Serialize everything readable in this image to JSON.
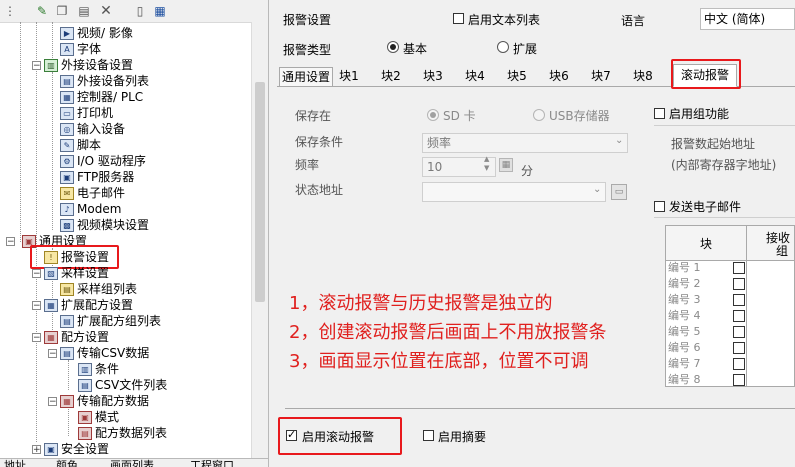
{
  "tree": {
    "items": [
      {
        "label": "视频/ 影像"
      },
      {
        "label": "字体"
      },
      {
        "label": "外接设备设置"
      },
      {
        "label": "外接设备列表"
      },
      {
        "label": "控制器/ PLC"
      },
      {
        "label": "打印机"
      },
      {
        "label": "输入设备"
      },
      {
        "label": "脚本"
      },
      {
        "label": "I/O 驱动程序"
      },
      {
        "label": "FTP服务器"
      },
      {
        "label": "电子邮件"
      },
      {
        "label": "Modem"
      },
      {
        "label": "视频模块设置"
      },
      {
        "label": "通用设置"
      },
      {
        "label": "报警设置"
      },
      {
        "label": "采样设置"
      },
      {
        "label": "采样组列表"
      },
      {
        "label": "扩展配方设置"
      },
      {
        "label": "扩展配方组列表"
      },
      {
        "label": "配方设置"
      },
      {
        "label": "传输CSV数据"
      },
      {
        "label": "条件"
      },
      {
        "label": "CSV文件列表"
      },
      {
        "label": "传输配方数据"
      },
      {
        "label": "模式"
      },
      {
        "label": "配方数据列表"
      },
      {
        "label": "安全设置"
      }
    ],
    "bottom_tabs": [
      "地址",
      "颜色",
      "画面列表",
      "工程窗口"
    ]
  },
  "header": {
    "title": "报警设置",
    "enable_text_list": "启用文本列表",
    "language_label": "语言",
    "language_value": "中文 (简体)",
    "alarm_type_label": "报警类型",
    "type_basic": "基本",
    "type_extended": "扩展"
  },
  "tabs": [
    "通用设置",
    "块1",
    "块2",
    "块3",
    "块4",
    "块5",
    "块6",
    "块7",
    "块8",
    "滚动报警"
  ],
  "form": {
    "save_to_label": "保存在",
    "sd_card": "SD 卡",
    "usb": "USB存储器",
    "save_condition_label": "保存条件",
    "save_condition_value": "频率",
    "frequency_label": "频率",
    "frequency_value": "10",
    "frequency_unit": "分",
    "status_address_label": "状态地址",
    "status_address_value": "",
    "enable_group": "启用组功能",
    "alarm_start_address": "报警数起始地址",
    "internal_register": "(内部寄存器字地址)",
    "send_email": "发送电子邮件",
    "table_col_block": "块",
    "table_col_receive": "接收",
    "table_col_receive2": "组",
    "table_rows": [
      "编号 1",
      "编号 2",
      "编号 3",
      "编号 4",
      "编号 5",
      "编号 6",
      "编号 7",
      "编号 8"
    ]
  },
  "notes": [
    "1，滚动报警与历史报警是独立的",
    "2，创建滚动报警后画面上不用放报警条",
    "3，画面显示位置在底部，位置不可调"
  ],
  "footer": {
    "enable_scroll_alarm": "启用滚动报警",
    "enable_summary": "启用摘要"
  },
  "colors": {
    "highlight": "#e8191c",
    "note_text": "#e0201e",
    "panel_bg": "#f0f0f0"
  }
}
